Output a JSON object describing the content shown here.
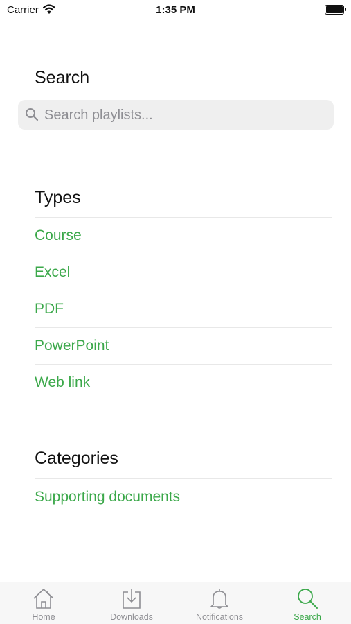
{
  "status": {
    "carrier": "Carrier",
    "time": "1:35 PM"
  },
  "search": {
    "title": "Search",
    "placeholder": "Search playlists..."
  },
  "types": {
    "title": "Types",
    "items": [
      "Course",
      "Excel",
      "PDF",
      "PowerPoint",
      "Web link"
    ]
  },
  "categories": {
    "title": "Categories",
    "items": [
      "Supporting documents"
    ]
  },
  "tabbar": {
    "active_color": "#3ba84a",
    "tabs": [
      {
        "label": "Home",
        "icon": "house-icon"
      },
      {
        "label": "Downloads",
        "icon": "download-tray-icon"
      },
      {
        "label": "Notifications",
        "icon": "bell-icon"
      },
      {
        "label": "Search",
        "icon": "search-icon",
        "active": true
      }
    ]
  }
}
